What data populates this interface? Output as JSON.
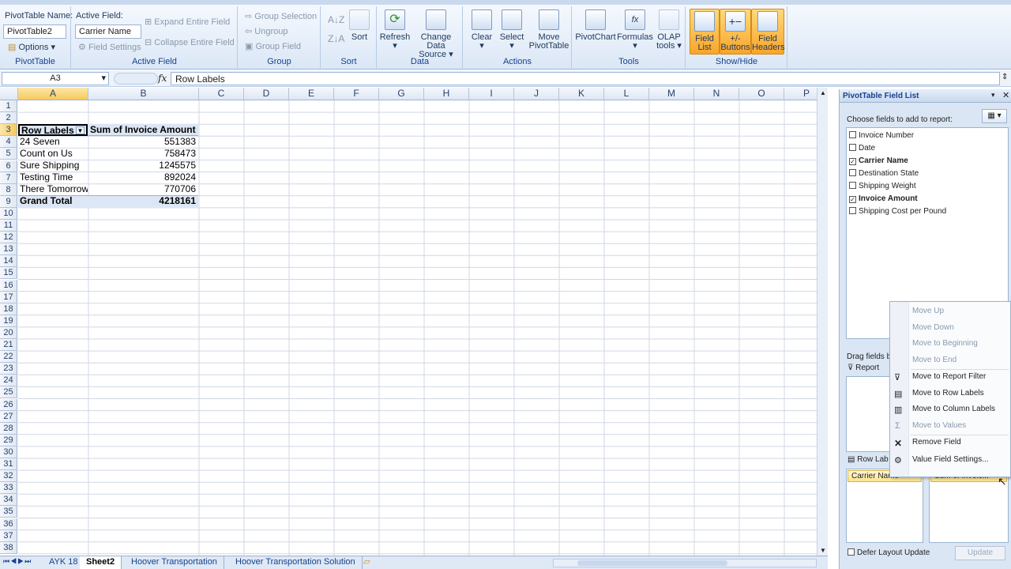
{
  "ribbon": {
    "pivottable": {
      "name_label": "PivotTable Name:",
      "name_value": "PivotTable2",
      "options": "Options",
      "group": "PivotTable"
    },
    "active_field": {
      "label": "Active Field:",
      "value": "Carrier Name",
      "settings": "Field Settings",
      "expand": "Expand Entire Field",
      "collapse": "Collapse Entire Field",
      "group": "Active Field"
    },
    "group": {
      "selection": "Group Selection",
      "ungroup": "Ungroup",
      "field": "Group Field",
      "group": "Group"
    },
    "sort": {
      "sort": "Sort",
      "group": "Sort"
    },
    "data": {
      "refresh": "Refresh",
      "change1": "Change Data",
      "change2": "Source",
      "group": "Data"
    },
    "actions": {
      "clear": "Clear",
      "select": "Select",
      "move1": "Move",
      "move2": "PivotTable",
      "group": "Actions"
    },
    "tools": {
      "chart": "PivotChart",
      "formulas": "Formulas",
      "olap1": "OLAP",
      "olap2": "tools",
      "group": "Tools"
    },
    "showhide": {
      "fl1": "Field",
      "fl2": "List",
      "pm1": "+/-",
      "pm2": "Buttons",
      "fh1": "Field",
      "fh2": "Headers",
      "group": "Show/Hide"
    }
  },
  "formula_bar": {
    "cell_ref": "A3",
    "fx": "fx",
    "content": "Row Labels"
  },
  "columns": [
    "A",
    "B",
    "C",
    "D",
    "E",
    "F",
    "G",
    "H",
    "I",
    "J",
    "K",
    "L",
    "M",
    "N",
    "O",
    "P"
  ],
  "pivot": {
    "header_a": "Row Labels",
    "header_b": "Sum of Invoice Amount",
    "rows": [
      {
        "label": "24 Seven",
        "value": "551383"
      },
      {
        "label": "Count on Us",
        "value": "758473"
      },
      {
        "label": "Sure Shipping",
        "value": "1245575"
      },
      {
        "label": "Testing Time",
        "value": "892024"
      },
      {
        "label": "There Tomorrow",
        "value": "770706"
      }
    ],
    "total_label": "Grand Total",
    "total_value": "4218161"
  },
  "sheet_tabs": [
    "AYK 18",
    "Sheet2",
    "Hoover Transportation",
    "Hoover Transportation Solution"
  ],
  "field_list": {
    "title": "PivotTable Field List",
    "choose": "Choose fields to add to report:",
    "fields": [
      {
        "name": "Invoice Number",
        "checked": false
      },
      {
        "name": "Date",
        "checked": false
      },
      {
        "name": "Carrier Name",
        "checked": true
      },
      {
        "name": "Destination State",
        "checked": false
      },
      {
        "name": "Shipping Weight",
        "checked": false
      },
      {
        "name": "Invoice Amount",
        "checked": true
      },
      {
        "name": "Shipping Cost per Pound",
        "checked": false
      }
    ],
    "drag": "Drag fields be",
    "report_filter": "Report",
    "row_labels": "Row Lab",
    "row_field": "Carrier Name",
    "value_field": "Sum of Invoic...",
    "defer": "Defer Layout Update",
    "update": "Update"
  },
  "context_menu": {
    "items": [
      {
        "label": "Move Up",
        "disabled": true
      },
      {
        "label": "Move Down",
        "disabled": true
      },
      {
        "label": "Move to Beginning",
        "disabled": true
      },
      {
        "label": "Move to End",
        "disabled": true
      },
      {
        "label": "Move to Report Filter",
        "disabled": false
      },
      {
        "label": "Move to Row Labels",
        "disabled": false
      },
      {
        "label": "Move to Column Labels",
        "disabled": false
      },
      {
        "label": "Move to Values",
        "disabled": true
      },
      {
        "label": "Remove Field",
        "disabled": false
      },
      {
        "label": "Value Field Settings...",
        "disabled": false
      }
    ]
  }
}
